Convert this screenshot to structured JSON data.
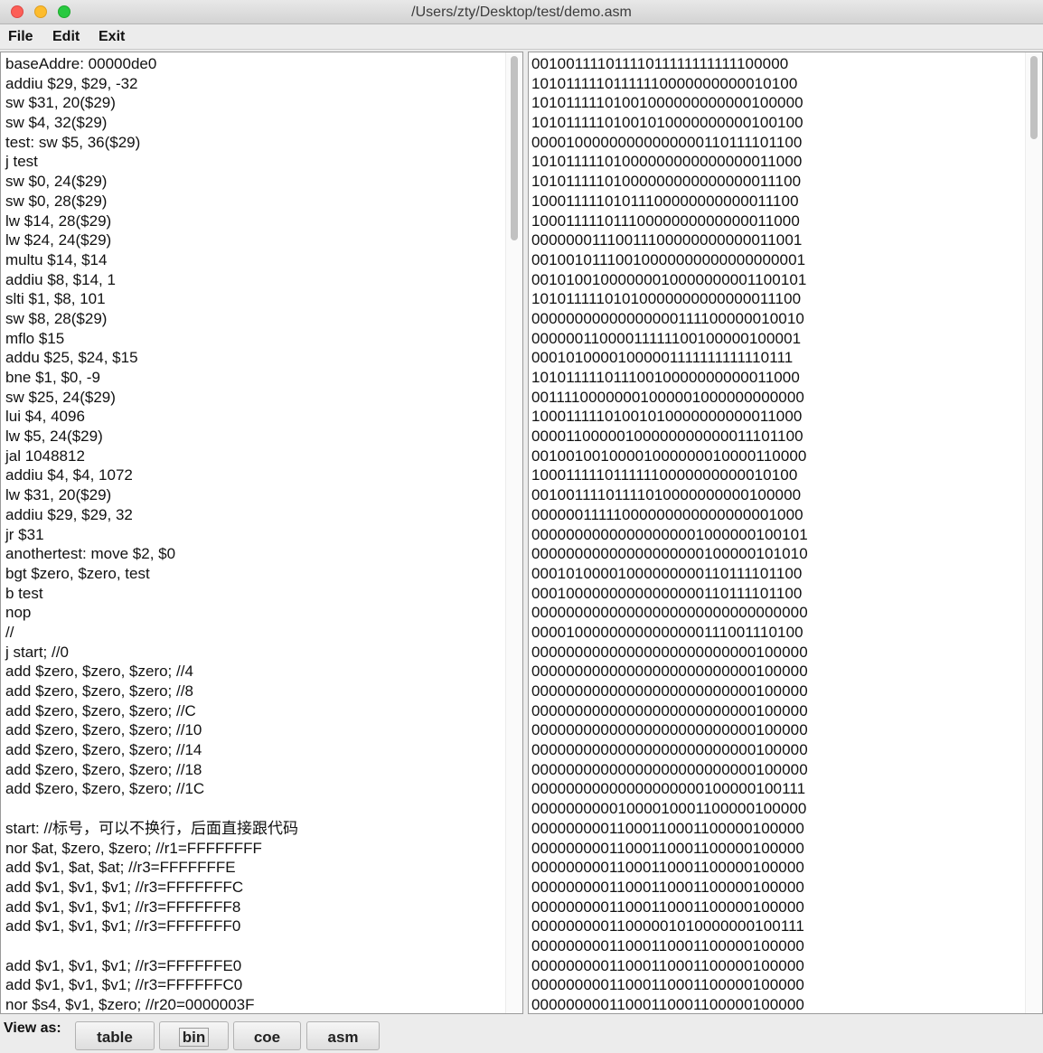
{
  "window": {
    "title": "/Users/zty/Desktop/test/demo.asm"
  },
  "menu": [
    "File",
    "Edit",
    "Exit"
  ],
  "asm_lines": [
    "baseAddre: 00000de0",
    "addiu $29, $29, -32",
    "sw $31, 20($29)",
    "sw $4, 32($29)",
    "test: sw $5, 36($29)",
    "j test",
    "sw $0, 24($29)",
    "sw $0, 28($29)",
    "lw $14, 28($29)",
    "lw $24, 24($29)",
    "multu $14, $14",
    "addiu $8, $14, 1",
    "slti $1, $8, 101",
    "sw $8, 28($29)",
    "mflo $15",
    "addu $25, $24, $15",
    "bne $1, $0, -9",
    "sw $25, 24($29)",
    "lui $4, 4096",
    "lw $5, 24($29)",
    "jal 1048812",
    "addiu $4, $4, 1072",
    "lw $31, 20($29)",
    "addiu $29, $29, 32",
    "jr $31",
    "anothertest: move $2, $0",
    "bgt $zero, $zero, test",
    "b test",
    "nop",
    "//",
    "j start; //0",
    "add $zero, $zero, $zero; //4",
    "add $zero, $zero, $zero; //8",
    "add $zero, $zero, $zero; //C",
    "add $zero, $zero, $zero; //10",
    "add $zero, $zero, $zero; //14",
    "add $zero, $zero, $zero; //18",
    "add $zero, $zero, $zero; //1C",
    "",
    "start: //标号，可以不换行，后面直接跟代码",
    "nor $at, $zero, $zero; //r1=FFFFFFFF",
    "add $v1, $at, $at; //r3=FFFFFFFE",
    "add $v1, $v1, $v1; //r3=FFFFFFFC",
    "add $v1, $v1, $v1; //r3=FFFFFFF8",
    "add $v1, $v1, $v1; //r3=FFFFFFF0",
    "",
    "add $v1, $v1, $v1; //r3=FFFFFFE0",
    "add $v1, $v1, $v1; //r3=FFFFFFC0",
    "nor $s4, $v1, $zero; //r20=0000003F"
  ],
  "bin_lines": [
    "00100111101111011111111111100000",
    "10101111101111110000000000010100",
    "10101111101001000000000000100000",
    "10101111101001010000000000100100",
    "00001000000000000000110111101100",
    "10101111101000000000000000011000",
    "10101111101000000000000000011100",
    "10001111101011100000000000011100",
    "10001111101110000000000000011000",
    "00000001110011100000000000011001",
    "00100101110010000000000000000001",
    "00101001000000010000000001100101",
    "10101111101010000000000000011100",
    "00000000000000000111100000010010",
    "00000011000011111100100000100001",
    "00010100001000001111111111110111",
    "10101111101110010000000000011000",
    "00111100000001000001000000000000",
    "10001111101001010000000000011000",
    "00001100000100000000000011101100",
    "00100100100001000000010000110000",
    "10001111101111110000000000010100",
    "00100111101111010000000000100000",
    "00000011111000000000000000001000",
    "00000000000000000001000000100101",
    "00000000000000000000100000101010",
    "00010100001000000000110111101100",
    "00010000000000000000110111101100",
    "00000000000000000000000000000000",
    "00001000000000000000111001110100",
    "00000000000000000000000000100000",
    "00000000000000000000000000100000",
    "00000000000000000000000000100000",
    "00000000000000000000000000100000",
    "00000000000000000000000000100000",
    "00000000000000000000000000100000",
    "00000000000000000000000000100000",
    "00000000000000000000100000100111",
    "00000000001000010001100000100000",
    "00000000011000110001100000100000",
    "00000000011000110001100000100000",
    "00000000011000110001100000100000",
    "00000000011000110001100000100000",
    "00000000011000110001100000100000",
    "00000000011000001010000000100111",
    "00000000011000110001100000100000",
    "00000000011000110001100000100000",
    "00000000011000110001100000100000",
    "00000000011000110001100000100000"
  ],
  "bottom": {
    "view_as_label": "View as:",
    "buttons": [
      "table",
      "bin",
      "coe",
      "asm"
    ],
    "selected": "bin"
  }
}
